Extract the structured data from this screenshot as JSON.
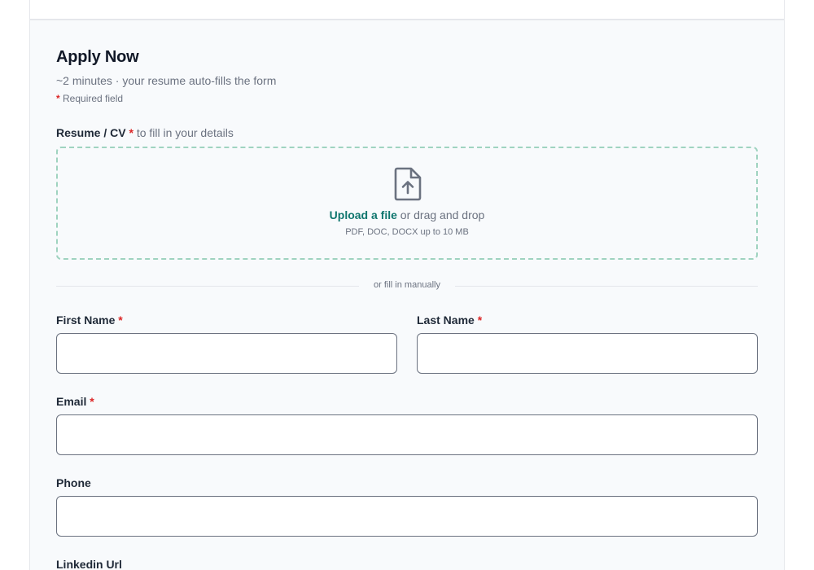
{
  "form": {
    "title": "Apply Now",
    "subtitle": "~2 minutes · your resume auto-fills the form",
    "required_star": "*",
    "required_note": "Required field"
  },
  "resume": {
    "label": "Resume / CV",
    "required_star": "*",
    "hint": "to fill in your details",
    "upload_link": "Upload a file",
    "upload_rest": " or drag and drop",
    "limits": "PDF, DOC, DOCX up to 10 MB",
    "icon": "file-upload-icon"
  },
  "divider": {
    "text": "or fill in manually"
  },
  "fields": {
    "first_name": {
      "label": "First Name",
      "required_star": "*",
      "value": "",
      "placeholder": ""
    },
    "last_name": {
      "label": "Last Name",
      "required_star": "*",
      "value": "",
      "placeholder": ""
    },
    "email": {
      "label": "Email",
      "required_star": "*",
      "value": "",
      "placeholder": ""
    },
    "phone": {
      "label": "Phone",
      "value": "",
      "placeholder": ""
    },
    "linkedin": {
      "label": "Linkedin Url"
    }
  },
  "colors": {
    "accent": "#0f766e",
    "required": "#dc2626",
    "dropzone_border": "#9fd3c0",
    "card_background": "#f8fafc"
  }
}
